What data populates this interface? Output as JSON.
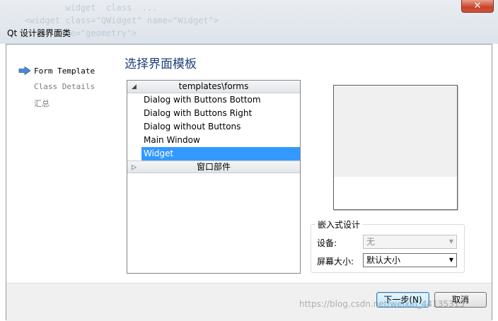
{
  "window": {
    "title": "Qt 设计器界面类",
    "close_label": "✕",
    "background_code": [
      "          widget  class  ...",
      "  <widget class=\"QWidget\" name=\"Widget\">",
      "     <y name=\"geometry\">"
    ]
  },
  "wizard_nav": {
    "items": [
      {
        "label": "Form Template",
        "active": true
      },
      {
        "label": "Class Details",
        "active": false
      },
      {
        "label": "汇总",
        "active": false
      }
    ]
  },
  "page": {
    "title": "选择界面模板"
  },
  "template_tree": {
    "groups": [
      {
        "label": "templates\\forms",
        "expanded": true,
        "items": [
          {
            "label": "Dialog with Buttons Bottom",
            "selected": false
          },
          {
            "label": "Dialog with Buttons Right",
            "selected": false
          },
          {
            "label": "Dialog without Buttons",
            "selected": false
          },
          {
            "label": "Main Window",
            "selected": false
          },
          {
            "label": "Widget",
            "selected": true
          }
        ]
      },
      {
        "label": "窗口部件",
        "expanded": false,
        "items": []
      }
    ]
  },
  "embedded_design": {
    "title": "嵌入式设计",
    "device_label": "设备:",
    "device_value": "无",
    "screen_size_label": "屏幕大小:",
    "screen_size_value": "默认大小"
  },
  "buttons": {
    "next_label": "下一步(N)",
    "cancel_label": "取消"
  },
  "watermark": "https://blog.csdn.net/weixin_44135315",
  "colors": {
    "selection": "#3399ff",
    "title_blue": "#1f3f7a",
    "nav_arrow": "#4a8ad8"
  }
}
